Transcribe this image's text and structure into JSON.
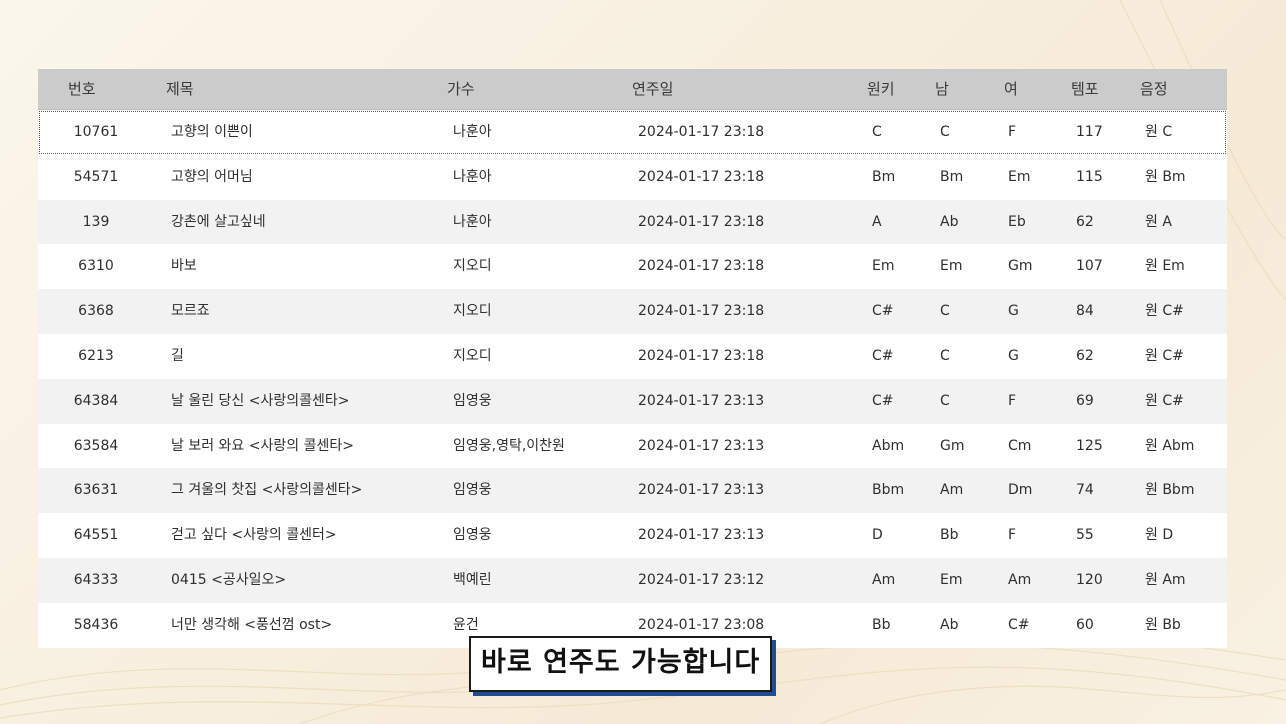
{
  "table": {
    "headers": {
      "no": "번호",
      "title": "제목",
      "singer": "가수",
      "date": "연주일",
      "key": "원키",
      "male": "남",
      "female": "여",
      "tempo": "템포",
      "pitch": "음정"
    },
    "rows": [
      {
        "no": "10761",
        "title": "고향의 이쁜이",
        "singer": "나훈아",
        "date": "2024-01-17 23:18",
        "key": "C",
        "male": "C",
        "female": "F",
        "tempo": "117",
        "pitch": "원 C"
      },
      {
        "no": "54571",
        "title": "고향의 어머님",
        "singer": "나훈아",
        "date": "2024-01-17 23:18",
        "key": "Bm",
        "male": "Bm",
        "female": "Em",
        "tempo": "115",
        "pitch": "원 Bm"
      },
      {
        "no": "139",
        "title": "강촌에 살고싶네",
        "singer": "나훈아",
        "date": "2024-01-17 23:18",
        "key": "A",
        "male": "Ab",
        "female": "Eb",
        "tempo": "62",
        "pitch": "원 A"
      },
      {
        "no": "6310",
        "title": "바보",
        "singer": "지오디",
        "date": "2024-01-17 23:18",
        "key": "Em",
        "male": "Em",
        "female": "Gm",
        "tempo": "107",
        "pitch": "원 Em"
      },
      {
        "no": "6368",
        "title": "모르죠",
        "singer": "지오디",
        "date": "2024-01-17 23:18",
        "key": "C#",
        "male": "C",
        "female": "G",
        "tempo": "84",
        "pitch": "원 C#"
      },
      {
        "no": "6213",
        "title": "길",
        "singer": "지오디",
        "date": "2024-01-17 23:18",
        "key": "C#",
        "male": "C",
        "female": "G",
        "tempo": "62",
        "pitch": "원 C#"
      },
      {
        "no": "64384",
        "title": "날 울린 당신 <사랑의콜센타>",
        "singer": "임영웅",
        "date": "2024-01-17 23:13",
        "key": "C#",
        "male": "C",
        "female": "F",
        "tempo": "69",
        "pitch": "원 C#"
      },
      {
        "no": "63584",
        "title": "날 보러 와요 <사랑의 콜센타>",
        "singer": "임영웅,영탁,이찬원",
        "date": "2024-01-17 23:13",
        "key": "Abm",
        "male": "Gm",
        "female": "Cm",
        "tempo": "125",
        "pitch": "원 Abm"
      },
      {
        "no": "63631",
        "title": "그 겨울의 찻집 <사랑의콜센타>",
        "singer": "임영웅",
        "date": "2024-01-17 23:13",
        "key": "Bbm",
        "male": "Am",
        "female": "Dm",
        "tempo": "74",
        "pitch": "원 Bbm"
      },
      {
        "no": "64551",
        "title": "걷고 싶다 <사랑의 콜센터>",
        "singer": "임영웅",
        "date": "2024-01-17 23:13",
        "key": "D",
        "male": "Bb",
        "female": "F",
        "tempo": "55",
        "pitch": "원 D"
      },
      {
        "no": "64333",
        "title": "0415 <공사일오>",
        "singer": "백예린",
        "date": "2024-01-17 23:12",
        "key": "Am",
        "male": "Em",
        "female": "Am",
        "tempo": "120",
        "pitch": "원 Am"
      },
      {
        "no": "58436",
        "title": "너만 생각해 <풍선껌 ost>",
        "singer": "윤건",
        "date": "2024-01-17 23:08",
        "key": "Bb",
        "male": "Ab",
        "female": "C#",
        "tempo": "60",
        "pitch": "원 Bb"
      }
    ]
  },
  "subtitle": "바로 연주도 가능합니다",
  "colors": {
    "header_bg": "#cbcbcb",
    "alt_row_bg": "#f2f2f2",
    "subtitle_shadow": "#1e4f96"
  }
}
